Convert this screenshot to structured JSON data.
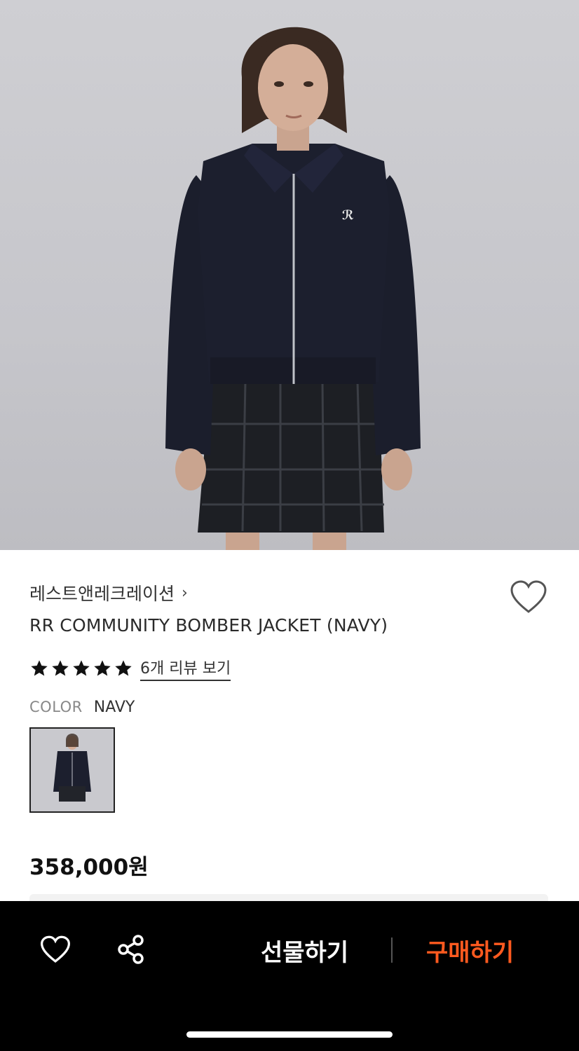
{
  "product": {
    "brand": "레스트앤레크레이션",
    "brand_chevron": "›",
    "title": "RR COMMUNITY BOMBER JACKET (NAVY)",
    "rating_stars": 5,
    "review_link": "6개 리뷰 보기",
    "color_label": "COLOR",
    "color_value": "NAVY",
    "price": "358,000원"
  },
  "bottom_bar": {
    "gift_label": "선물하기",
    "buy_label": "구매하기"
  },
  "colors": {
    "accent": "#ff5a1f",
    "bar_bg": "#000000",
    "text": "#222222"
  },
  "icons": {
    "wishlist": "heart-icon",
    "share": "share-icon",
    "rating": "star-icon"
  }
}
